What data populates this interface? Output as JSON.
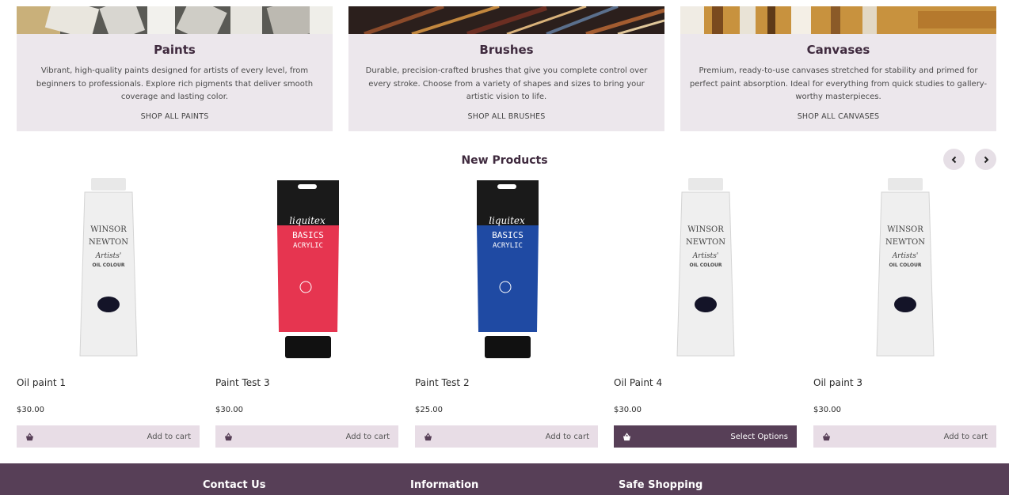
{
  "categories": [
    {
      "title": "Paints",
      "description": "Vibrant, high-quality paints designed for artists of every level, from beginners to professionals. Explore rich pigments that deliver smooth coverage and lasting color.",
      "link": "SHOP ALL PAINTS"
    },
    {
      "title": "Brushes",
      "description": "Durable, precision-crafted brushes that give you complete control over every stroke. Choose from a variety of shapes and sizes to bring your artistic vision to life.",
      "link": "SHOP ALL BRUSHES"
    },
    {
      "title": "Canvases",
      "description": "Premium, ready-to-use canvases stretched for stability and primed for perfect paint absorption. Ideal for everything from quick studies to gallery-worthy masterpieces.",
      "link": "SHOP ALL CANVASES"
    }
  ],
  "new_products": {
    "title": "New Products",
    "prev_icon": "chevron-left-icon",
    "next_icon": "chevron-right-icon",
    "items": [
      {
        "name": "Oil paint 1",
        "price": "$30.00",
        "button": "Add to cart",
        "tube": "winsor"
      },
      {
        "name": "Paint Test 3",
        "price": "$30.00",
        "button": "Add to cart",
        "tube": "liquitex-red"
      },
      {
        "name": "Paint Test 2",
        "price": "$25.00",
        "button": "Add to cart",
        "tube": "liquitex-blue"
      },
      {
        "name": "Oil Paint 4",
        "price": "$30.00",
        "button": "Select Options",
        "tube": "winsor"
      },
      {
        "name": "Oil paint 3",
        "price": "$30.00",
        "button": "Add to cart",
        "tube": "winsor"
      }
    ]
  },
  "tube_labels": {
    "winsor_brand_1": "WINSOR",
    "winsor_brand_2": "NEWTON",
    "winsor_line": "Artists'",
    "winsor_type": "OIL COLOUR",
    "liquitex_brand": "liquitex",
    "liquitex_line_1": "BASICS",
    "liquitex_line_2": "ACRYLIC"
  },
  "footer": {
    "col1": "Contact Us",
    "col2": "Information",
    "col3": "Safe Shopping"
  },
  "colors": {
    "accent": "#573f57",
    "card_bg": "#ece7ec",
    "button_bg": "#e8dde6"
  }
}
